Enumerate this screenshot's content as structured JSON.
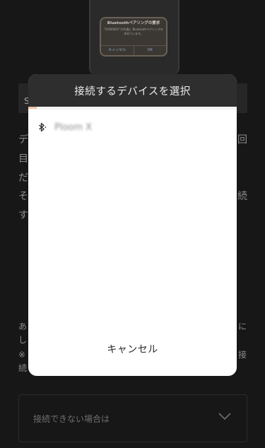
{
  "background": {
    "phone_alert": {
      "title": "Bluetoothペアリングの要求",
      "message": "\"IU000001\"が共通に Bluetoothペアリングを求めています。",
      "cancel": "キャンセル",
      "ok": "OK"
    },
    "bar_char": "S",
    "left_chars": [
      "デ",
      "目",
      "だ",
      "そ",
      "す"
    ],
    "right_chars": [
      "回",
      "続"
    ],
    "lower_left_chars": [
      "あ",
      "し",
      "※",
      "続"
    ],
    "lower_right_chars": [
      "に",
      "接"
    ],
    "faq_label": "接続できない場合は"
  },
  "dialog": {
    "title": "接続するデバイスを選択",
    "progress": 0.04,
    "devices": [
      {
        "name": "Ploom X",
        "icon": "bluetooth-icon"
      }
    ],
    "cancel_label": "キャンセル"
  },
  "colors": {
    "dialog_header": "#2e2e2e",
    "backdrop": "#151515",
    "accent": "#f0c4a8"
  }
}
